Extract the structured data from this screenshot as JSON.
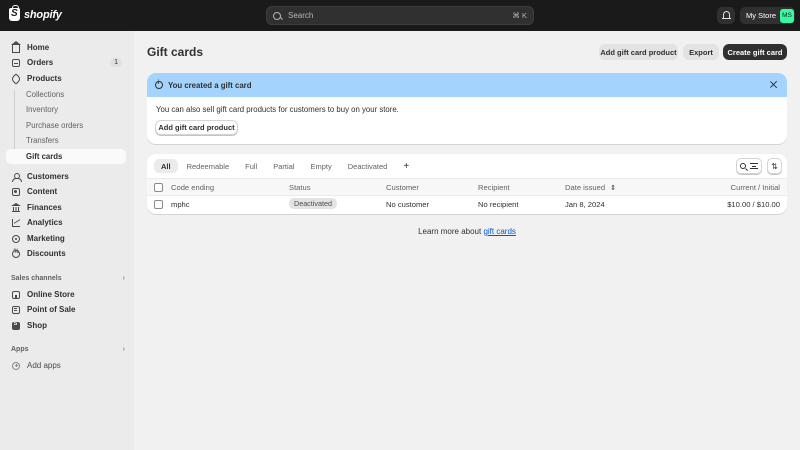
{
  "topbar": {
    "logo_text": "shopify",
    "search_placeholder": "Search",
    "search_shortcut": "⌘ K",
    "store_name": "My Store",
    "avatar_initials": "MS"
  },
  "sidebar": {
    "home": "Home",
    "orders": "Orders",
    "orders_count": "1",
    "products": "Products",
    "sub_items": [
      "Collections",
      "Inventory",
      "Purchase orders",
      "Transfers",
      "Gift cards"
    ],
    "customers": "Customers",
    "content": "Content",
    "finances": "Finances",
    "analytics": "Analytics",
    "marketing": "Marketing",
    "discounts": "Discounts",
    "sales_channels_label": "Sales channels",
    "online_store": "Online Store",
    "point_of_sale": "Point of Sale",
    "shop": "Shop",
    "apps_label": "Apps",
    "add_apps": "Add apps"
  },
  "main": {
    "title": "Gift cards",
    "add_gift_card_product": "Add gift card product",
    "export": "Export",
    "create_gift_card": "Create gift card"
  },
  "banner": {
    "title": "You created a gift card",
    "body": "You can also sell gift card products for customers to buy on your store.",
    "button": "Add gift card product"
  },
  "table": {
    "tabs": [
      "All",
      "Redeemable",
      "Full",
      "Partial",
      "Empty",
      "Deactivated",
      "+"
    ],
    "headers": {
      "code": "Code ending",
      "status": "Status",
      "customer": "Customer",
      "recipient": "Recipient",
      "date": "Date issued",
      "balance": "Current / Initial"
    },
    "rows": [
      {
        "code": "mphc",
        "status": "Deactivated",
        "customer": "No customer",
        "recipient": "No recipient",
        "date": "Jan 8, 2024",
        "balance": "$10.00 / $10.00"
      }
    ]
  },
  "footer": {
    "learn_prefix": "Learn more about",
    "learn_link": "gift cards"
  }
}
